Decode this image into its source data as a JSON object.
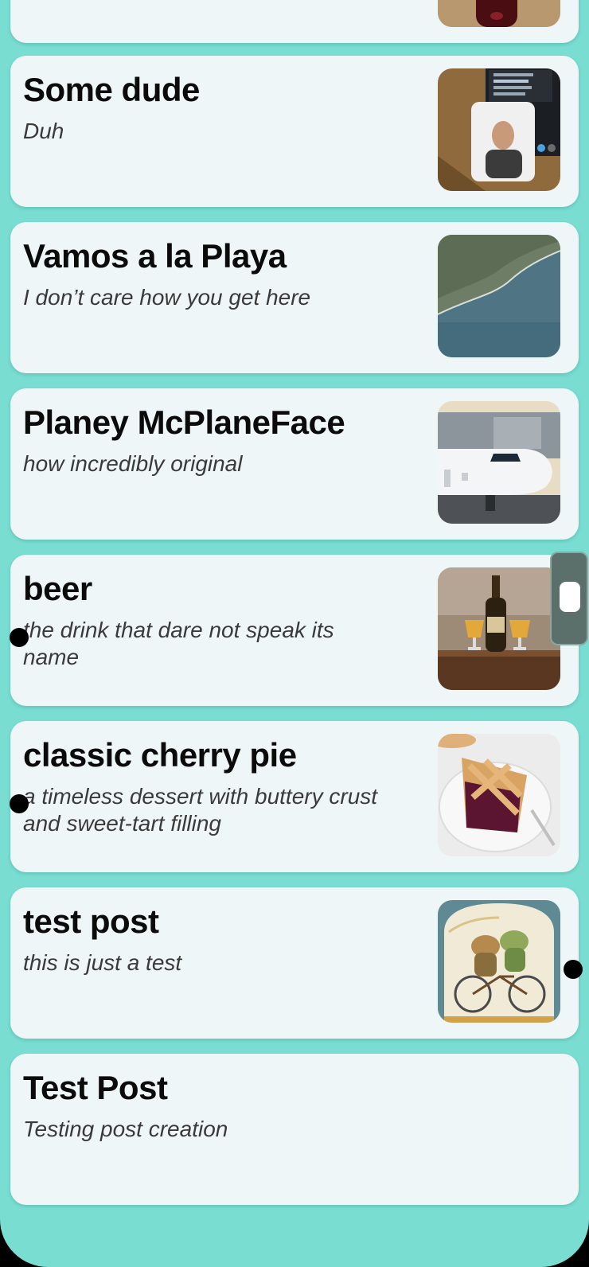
{
  "posts": [
    {
      "title": "",
      "subtitle": "",
      "image": "wine-bottle-thumbnail"
    },
    {
      "title": "Some dude",
      "subtitle": "Duh",
      "image": "laptop-video-call-thumbnail"
    },
    {
      "title": "Vamos a la Playa",
      "subtitle": "I don’t care how you get here",
      "image": "coastline-aerial-thumbnail"
    },
    {
      "title": "Planey McPlaneFace",
      "subtitle": "how incredibly original",
      "image": "airplane-thumbnail"
    },
    {
      "title": "beer",
      "subtitle": "the drink that dare not speak its name",
      "image": "beer-bottle-glasses-thumbnail"
    },
    {
      "title": "classic cherry pie",
      "subtitle": "a timeless dessert with buttery crust and sweet-tart filling",
      "image": "cherry-pie-slice-thumbnail"
    },
    {
      "title": "test post",
      "subtitle": "this is just a test",
      "image": "frogs-on-bicycle-thumbnail"
    },
    {
      "title": "Test Post",
      "subtitle": "Testing post creation",
      "image": ""
    }
  ],
  "theme": {
    "background": "#79ddd1",
    "card": "#eff6f7",
    "title_color": "#0b0b0b",
    "subtitle_color": "#3a3a3a"
  }
}
